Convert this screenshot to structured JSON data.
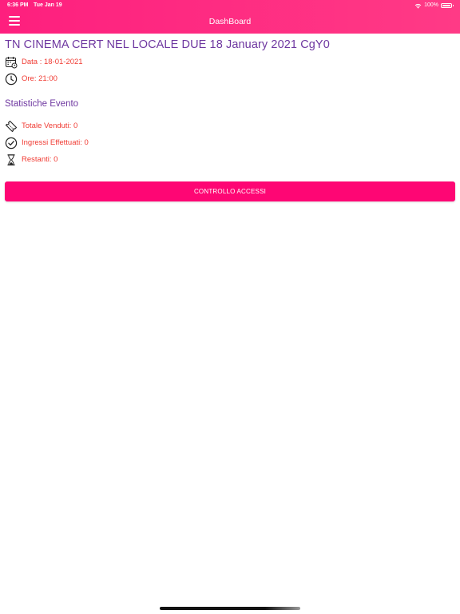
{
  "status_bar": {
    "time": "6:36 PM",
    "date": "Tue Jan 19",
    "battery": "100%"
  },
  "nav": {
    "title": "DashBoard",
    "menu_icon": "hamburger-icon"
  },
  "event": {
    "title": "TN CINEMA CERT NEL LOCALE DUE 18 January 2021 CgY0",
    "date_label": "Data : 18-01-2021",
    "time_label": "Ore: 21:00"
  },
  "stats": {
    "section_title": "Statistiche Evento",
    "sold": "Totale Venduti: 0",
    "entries": "Ingressi Effettuati: 0",
    "remaining": "Restanti: 0"
  },
  "actions": {
    "access_control": "CONTROLLO ACCESSI"
  },
  "colors": {
    "primary": "#fe0674",
    "header": "#ff2a82",
    "title": "#6e37a0",
    "value_text": "#f03b33"
  }
}
